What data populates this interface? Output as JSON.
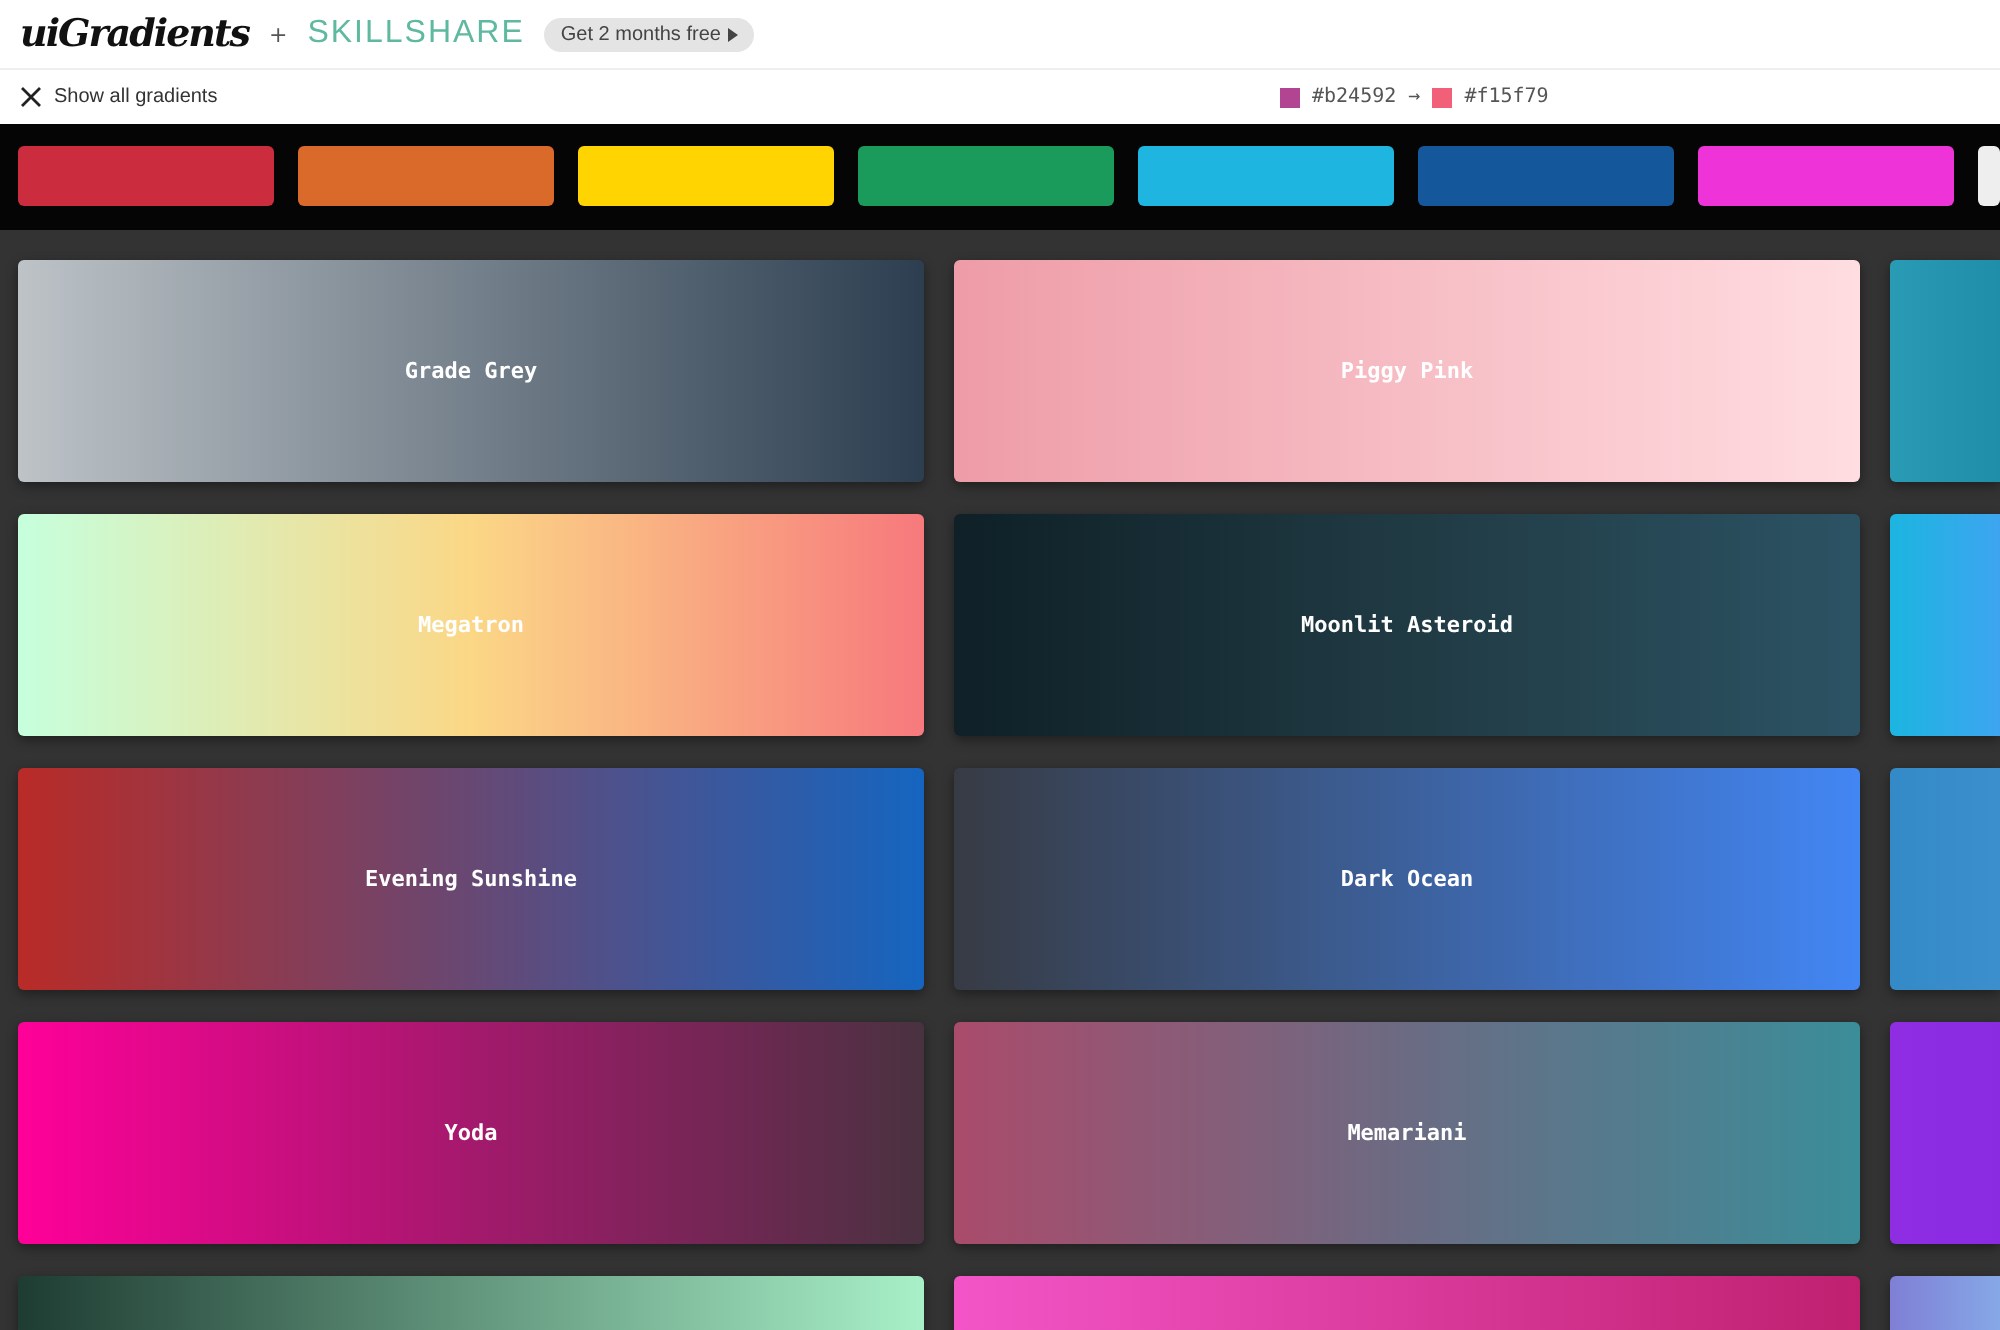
{
  "header": {
    "logo": "uiGradients",
    "plus": "+",
    "partner": "SKILLSHARE",
    "promo": "Get 2 months free"
  },
  "toolbar": {
    "show_all": "Show all gradients",
    "from": {
      "color": "#b24592",
      "code": "#b24592"
    },
    "arrow": "→",
    "to": {
      "color": "#f15f79",
      "code": "#f15f79"
    }
  },
  "color_filters": [
    {
      "color": "#cb2d3e"
    },
    {
      "color": "#da6a2a"
    },
    {
      "color": "#ffd400"
    },
    {
      "color": "#1a9b5b"
    },
    {
      "color": "#1eb6e0"
    },
    {
      "color": "#14579b"
    },
    {
      "color": "#ee34d9"
    },
    {
      "color": "#eeeeee"
    }
  ],
  "gradients": [
    {
      "name": "Grade Grey",
      "stops": [
        {
          "color": "#bdc3c7"
        },
        {
          "color": "#2c3e50"
        }
      ]
    },
    {
      "name": "Piggy Pink",
      "stops": [
        {
          "color": "#ee9ca7"
        },
        {
          "color": "#ffdde1"
        }
      ]
    },
    {
      "stops": [
        {
          "color": "#2a9bb5"
        },
        {
          "color": "#1f8ea8"
        }
      ]
    },
    {
      "name": "Megatron",
      "stops": [
        {
          "color": "#c6ffdd"
        },
        {
          "color": "#fbd786"
        },
        {
          "color": "#f7797d"
        }
      ]
    },
    {
      "name": "Moonlit Asteroid",
      "stops": [
        {
          "color": "#0f2027"
        },
        {
          "color": "#203a43"
        },
        {
          "color": "#2c5364"
        }
      ]
    },
    {
      "stops": [
        {
          "color": "#1cb5e0"
        },
        {
          "color": "#3da5f0"
        }
      ]
    },
    {
      "name": "Evening Sunshine",
      "stops": [
        {
          "color": "#b92b27"
        },
        {
          "color": "#1565c0"
        }
      ]
    },
    {
      "name": "Dark Ocean",
      "stops": [
        {
          "color": "#373b44"
        },
        {
          "color": "#4286f4"
        }
      ]
    },
    {
      "stops": [
        {
          "color": "#348ac7"
        },
        {
          "color": "#3a8fcc"
        }
      ]
    },
    {
      "name": "Yoda",
      "stops": [
        {
          "color": "#ff0099"
        },
        {
          "color": "#493240"
        }
      ]
    },
    {
      "name": "Memariani",
      "stops": [
        {
          "color": "#aa4b6b"
        },
        {
          "color": "#6b6b83"
        },
        {
          "color": "#3b8d99"
        }
      ]
    },
    {
      "stops": [
        {
          "color": "#8e2de2"
        },
        {
          "color": "#8a2be2"
        }
      ]
    },
    {
      "stops": [
        {
          "color": "#1e3c32"
        },
        {
          "color": "#a8f0c8"
        }
      ]
    },
    {
      "stops": [
        {
          "color": "#f355c8"
        },
        {
          "color": "#c0206f"
        }
      ]
    },
    {
      "stops": [
        {
          "color": "#7f7fd5"
        },
        {
          "color": "#86a8e7"
        }
      ]
    }
  ]
}
